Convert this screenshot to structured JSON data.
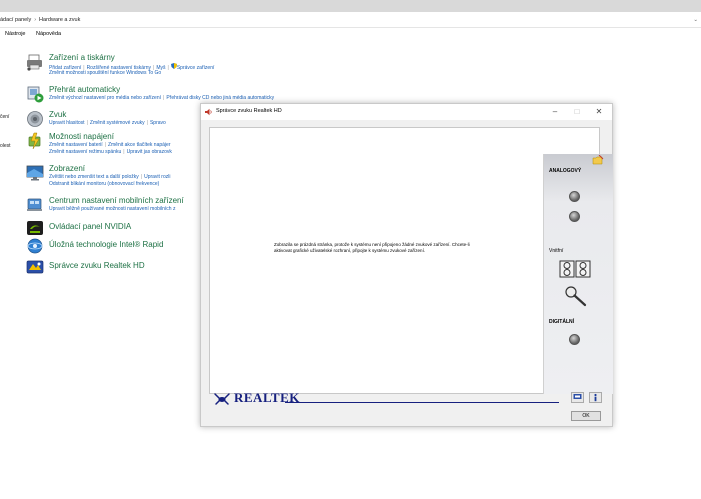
{
  "address_bar": {
    "crumb_parent": "ádací panely",
    "crumb_separator": "›",
    "crumb_current": "Hardware a zvuk",
    "chevron": "⌄"
  },
  "menubar": {
    "items": [
      "Nástroje",
      "Nápověda"
    ]
  },
  "left_stubs": [
    "čení",
    "olest"
  ],
  "categories": [
    {
      "title": "Zařízení a tiskárny",
      "icon": "printer-icon",
      "lines": [
        [
          "Přidat zařízení",
          "Rozšířené nastavení tiskárny",
          "Myš",
          "Správce zařízení"
        ],
        [
          "Změnit možnosti spouštění funkce Windows To Go"
        ]
      ]
    },
    {
      "title": "Přehrát automaticky",
      "icon": "autoplay-icon",
      "lines": [
        [
          "Změnit výchozí nastavení pro média nebo zařízení",
          "Přehrávat disky CD nebo jiná média automaticky"
        ]
      ]
    },
    {
      "title": "Zvuk",
      "icon": "speaker-icon",
      "lines": [
        [
          "Upravit hlasitost",
          "Změnit systémové zvuky",
          "Spravo"
        ]
      ]
    },
    {
      "title": "Možnosti napájení",
      "icon": "power-options-icon",
      "lines": [
        [
          "Změnit nastavení baterií",
          "Změnit akce tlačítek napájer"
        ],
        [
          "Změnit nastavení režimu spánku",
          "Upravit jas obrazovk"
        ]
      ]
    },
    {
      "title": "Zobrazení",
      "icon": "monitor-icon",
      "lines": [
        [
          "Zvětšit nebo zmenšit text a další položky",
          "Upravit rozli"
        ],
        [
          "Odstranit blikání monitoru (obnovovací frekvence)"
        ]
      ]
    },
    {
      "title": "Centrum nastavení mobilních zařízení",
      "icon": "mobility-center-icon",
      "lines": [
        [
          "Upravit běžně používané možnosti nastavení mobilních z"
        ]
      ]
    },
    {
      "title": "Ovládací panel NVIDIA",
      "icon": "nvidia-icon",
      "lines": []
    },
    {
      "title": "Úložná technologie Intel® Rapid",
      "icon": "intel-rst-icon",
      "lines": []
    },
    {
      "title": "Správce zvuku Realtek HD",
      "icon": "realtek-icon",
      "lines": []
    }
  ],
  "dialog": {
    "title": "Správce zvuku Realtek HD",
    "minimize": "–",
    "maximize": "□",
    "close": "✕",
    "message": "Zobrazila se prázdná stránka, protože k systému není připojeno žádné zvukové zařízení. Chcete-li aktivovat grafické uživatelské rozhraní, připojte k systému zvukové zařízení.",
    "panel": {
      "analog": "ANALOGOVÝ",
      "internal": "Vnitřní",
      "digital": "DIGITÁLNÍ"
    },
    "brand": "REALTEK",
    "ok": "OK"
  },
  "colors": {
    "link": "#1a5fb4",
    "category_title": "#1e7145",
    "realtek_blue": "#16207f"
  }
}
